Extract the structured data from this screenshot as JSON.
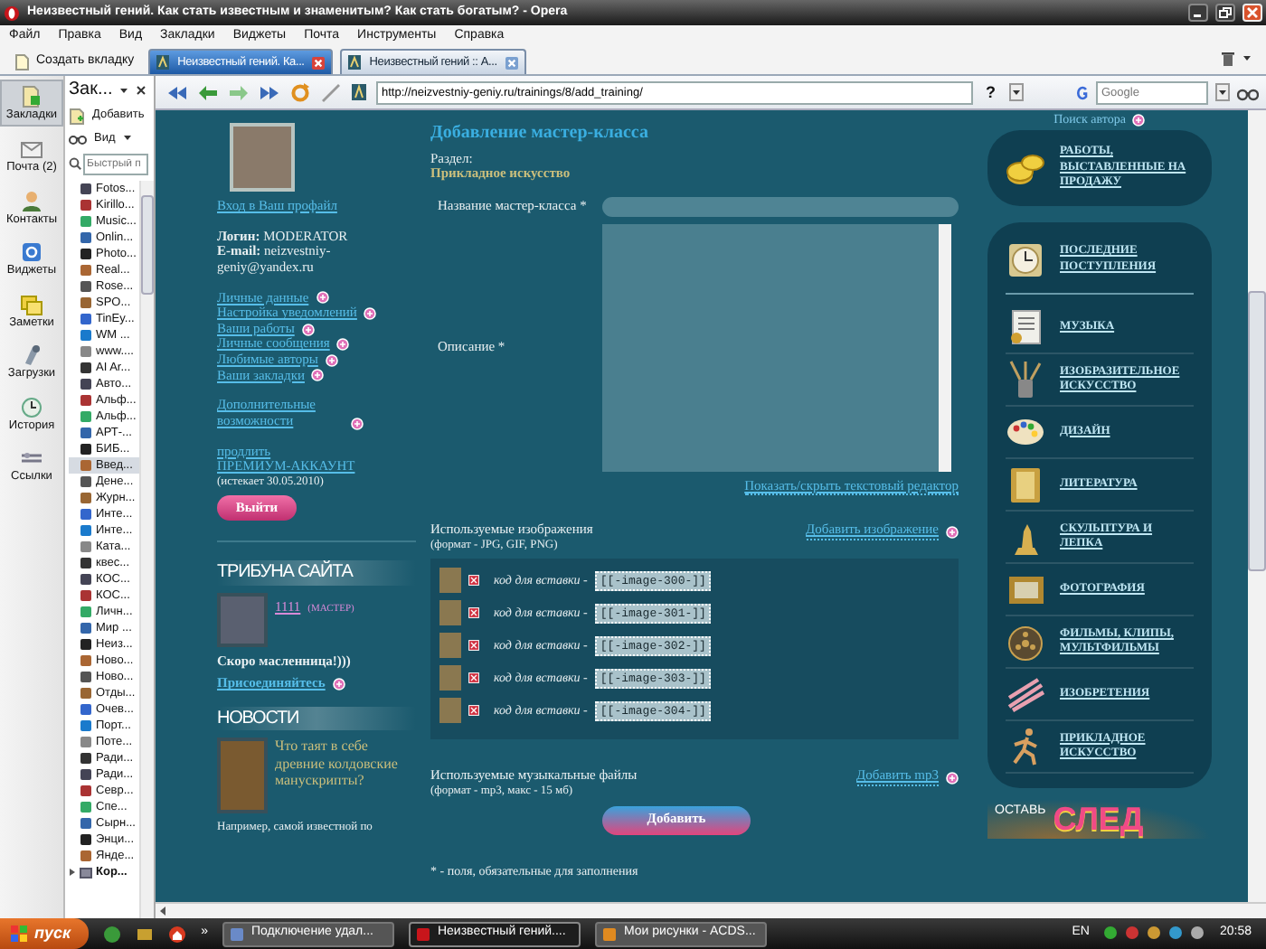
{
  "window": {
    "title": "Неизвестный гений. Как стать известным и знаменитым? Как стать богатым? - Opera"
  },
  "menu": [
    "Файл",
    "Правка",
    "Вид",
    "Закладки",
    "Виджеты",
    "Почта",
    "Инструменты",
    "Справка"
  ],
  "new_tab": "Создать вкладку",
  "tabs": [
    {
      "label": "Неизвестный гений. Ка...",
      "selected": true
    },
    {
      "label": "Неизвестный гений :: А...",
      "selected": false
    }
  ],
  "panels": [
    {
      "label": "Закладки",
      "selected": true
    },
    {
      "label": "Почта (2)",
      "selected": false
    },
    {
      "label": "Контакты",
      "selected": false
    },
    {
      "label": "Виджеты",
      "selected": false
    },
    {
      "label": "Заметки",
      "selected": false
    },
    {
      "label": "Загрузки",
      "selected": false
    },
    {
      "label": "История",
      "selected": false
    },
    {
      "label": "Ссылки",
      "selected": false
    }
  ],
  "bookmarks_panel": {
    "title": "Зак...",
    "add": "Добавить",
    "view": "Вид",
    "search_placeholder": "Быстрый п",
    "items": [
      {
        "label": "Fotos...",
        "kind": "link",
        "selected": false
      },
      {
        "label": "Kirillo...",
        "kind": "link",
        "selected": false
      },
      {
        "label": "Music...",
        "kind": "link",
        "selected": false
      },
      {
        "label": "Onlin...",
        "kind": "link",
        "selected": false
      },
      {
        "label": "Photo...",
        "kind": "link",
        "selected": false
      },
      {
        "label": "Real...",
        "kind": "link",
        "selected": false
      },
      {
        "label": "Rose...",
        "kind": "link",
        "selected": false
      },
      {
        "label": "SPO...",
        "kind": "link",
        "selected": false
      },
      {
        "label": "TinEy...",
        "kind": "link",
        "selected": false
      },
      {
        "label": "WM ...",
        "kind": "link",
        "selected": false
      },
      {
        "label": "www....",
        "kind": "link",
        "selected": false
      },
      {
        "label": "AI Ar...",
        "kind": "link",
        "selected": false
      },
      {
        "label": "Авто...",
        "kind": "link",
        "selected": false
      },
      {
        "label": "Альф...",
        "kind": "link",
        "selected": false
      },
      {
        "label": "Альф...",
        "kind": "link",
        "selected": false
      },
      {
        "label": "АРТ-...",
        "kind": "link",
        "selected": false
      },
      {
        "label": "БИБ...",
        "kind": "link",
        "selected": false
      },
      {
        "label": "Введ...",
        "kind": "link",
        "selected": true
      },
      {
        "label": "Дене...",
        "kind": "link",
        "selected": false
      },
      {
        "label": "Журн...",
        "kind": "link",
        "selected": false
      },
      {
        "label": "Инте...",
        "kind": "link",
        "selected": false
      },
      {
        "label": "Инте...",
        "kind": "link",
        "selected": false
      },
      {
        "label": "Ката...",
        "kind": "link",
        "selected": false
      },
      {
        "label": "квес...",
        "kind": "link",
        "selected": false
      },
      {
        "label": "КОС...",
        "kind": "link",
        "selected": false
      },
      {
        "label": "КОС...",
        "kind": "link",
        "selected": false
      },
      {
        "label": "Личн...",
        "kind": "link",
        "selected": false
      },
      {
        "label": "Мир ...",
        "kind": "link",
        "selected": false
      },
      {
        "label": "Неиз...",
        "kind": "link",
        "selected": false
      },
      {
        "label": "Ново...",
        "kind": "link",
        "selected": false
      },
      {
        "label": "Ново...",
        "kind": "link",
        "selected": false
      },
      {
        "label": "Отды...",
        "kind": "link",
        "selected": false
      },
      {
        "label": "Очев...",
        "kind": "link",
        "selected": false
      },
      {
        "label": "Порт...",
        "kind": "link",
        "selected": false
      },
      {
        "label": "Поте...",
        "kind": "link",
        "selected": false
      },
      {
        "label": "Ради...",
        "kind": "link",
        "selected": false
      },
      {
        "label": "Ради...",
        "kind": "link",
        "selected": false
      },
      {
        "label": "Севр...",
        "kind": "link",
        "selected": false
      },
      {
        "label": "Спе...",
        "kind": "link",
        "selected": false
      },
      {
        "label": "Сырн...",
        "kind": "link",
        "selected": false
      },
      {
        "label": "Энци...",
        "kind": "link",
        "selected": false
      },
      {
        "label": "Янде...",
        "kind": "link",
        "selected": false
      },
      {
        "label": "Кор...",
        "kind": "folder",
        "selected": false
      }
    ]
  },
  "address_bar": {
    "url": "http://neizvestniy-geniy.ru/trainings/8/add_training/",
    "help": "?",
    "search_placeholder": "Google"
  },
  "profile": {
    "login_link": "Вход в Ваш профайл",
    "login": "**Логин:** MODERATOR",
    "email": "**E-mail:** neizvestniy-geniy@yandex.ru",
    "links": [
      "Личные данные",
      "Настройка уведомлений",
      "Ваши работы",
      "Личные сообщения",
      "Любимые авторы",
      "Ваши закладки"
    ],
    "extra_link": "Дополнительные возможности",
    "renew_link": "продлить",
    "premium_link": "ПРЕМИУМ-АККАУНТ",
    "expires": "(истекает 30.05.2010)",
    "logout": "Выйти"
  },
  "tribune": {
    "title": "ТРИБУНА САЙТА",
    "user": "1111",
    "rank": "(МАСТЕР)",
    "message": "Скоро масленница!)))",
    "join_link": "Присоединяйтесь"
  },
  "news": {
    "title": "НОВОСТИ",
    "headline": "Что таят в себе древние колдовские манускрипты?",
    "excerpt": "Например, самой известной по"
  },
  "form": {
    "title": "Добавление мастер-класса",
    "section_label": "Раздел:",
    "section_value": "Прикладное искусство",
    "name_label": "Название мастер-класса *",
    "description_label": "Описание *",
    "editor_toggle": "Показать/скрыть текстовый редактор",
    "images": {
      "label": "Используемые изображения",
      "format": "(формат - JPG, GIF, PNG)",
      "add_link": "Добавить изображение",
      "items": [
        {
          "caption": "код для вставки -",
          "code": "[[-image-300-]]"
        },
        {
          "caption": "код для вставки -",
          "code": "[[-image-301-]]"
        },
        {
          "caption": "код для вставки -",
          "code": "[[-image-302-]]"
        },
        {
          "caption": "код для вставки -",
          "code": "[[-image-303-]]"
        },
        {
          "caption": "код для вставки -",
          "code": "[[-image-304-]]"
        }
      ]
    },
    "music": {
      "label": "Используемые музыкальные файлы",
      "format": "(формат - mp3, макс - 15 мб)",
      "add_link": "Добавить mp3"
    },
    "submit": "Добавить",
    "footnote": "* - поля, обязательные для заполнения"
  },
  "right": {
    "author_search": "Поиск автора",
    "sale": "РАБОТЫ, ВЫСТАВЛЕННЫЕ НА ПРОДАЖУ",
    "latest": "ПОСЛЕДНИЕ ПОСТУПЛЕНИЯ",
    "categories": [
      "МУЗЫКА",
      "ИЗОБРАЗИТЕЛЬНОЕ ИСКУССТВО",
      "ДИЗАЙН",
      "ЛИТЕРАТУРА",
      "СКУЛЬПТУРА И ЛЕПКА",
      "ФОТОГРАФИЯ",
      "ФИЛЬМЫ, КЛИПЫ, МУЛЬТФИЛЬМЫ",
      "ИЗОБРЕТЕНИЯ",
      "ПРИКЛАДНОЕ ИСКУССТВО"
    ],
    "banner_small": "ОСТАВЬ",
    "banner_big": "СЛЕД"
  },
  "taskbar": {
    "start": "пуск",
    "more": "»",
    "tasks": [
      {
        "label": "Подключение удал...",
        "selected": false
      },
      {
        "label": "Неизвестный гений....",
        "selected": true
      },
      {
        "label": "Мои рисунки - ACDS...",
        "selected": false
      }
    ],
    "language": "EN",
    "clock": "20:58"
  }
}
